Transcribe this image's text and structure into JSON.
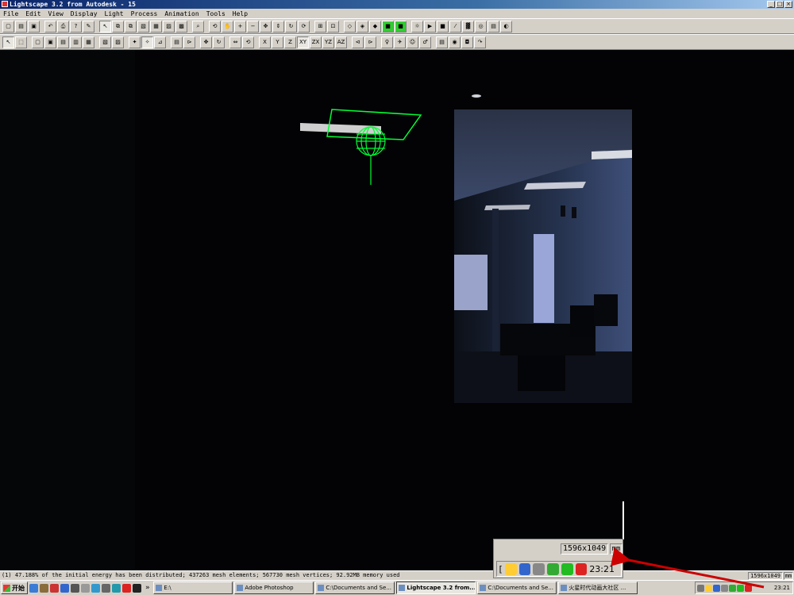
{
  "window": {
    "title": "Lightscape 3.2 from Autodesk - 15"
  },
  "menu": [
    "File",
    "Edit",
    "View",
    "Display",
    "Light",
    "Process",
    "Animation",
    "Tools",
    "Help"
  ],
  "toolbar_axes": [
    "X",
    "Y",
    "Z",
    "XY",
    "ZX",
    "YZ",
    "AZ"
  ],
  "status": {
    "message": "(1) 47.188% of the initial energy has been distributed; 437263 mesh elements; 567730 mesh vertices; 92.92MB memory used",
    "resolution": "1596x1049",
    "unit": "mm"
  },
  "callout": {
    "resolution": "1596x1049",
    "unit": "mm",
    "clock": "23:21",
    "bracket": "["
  },
  "taskbar": {
    "start_label": "开始",
    "overflow": "»",
    "tasks": [
      {
        "label": "E:\\",
        "active": false
      },
      {
        "label": "Adobe Photoshop",
        "active": false
      },
      {
        "label": "C:\\Documents and Se...",
        "active": false
      },
      {
        "label": "Lightscape 3.2 from...",
        "active": true
      },
      {
        "label": "C:\\Documents and Se...",
        "active": false
      },
      {
        "label": "火星时代动画大社区 ...",
        "active": false
      }
    ],
    "clock": "23:21"
  },
  "colors": {
    "gizmo": "#00ff33",
    "annotation_arrow": "#cc0000",
    "chrome": "#d4d0c8",
    "title_start": "#0a246a"
  }
}
